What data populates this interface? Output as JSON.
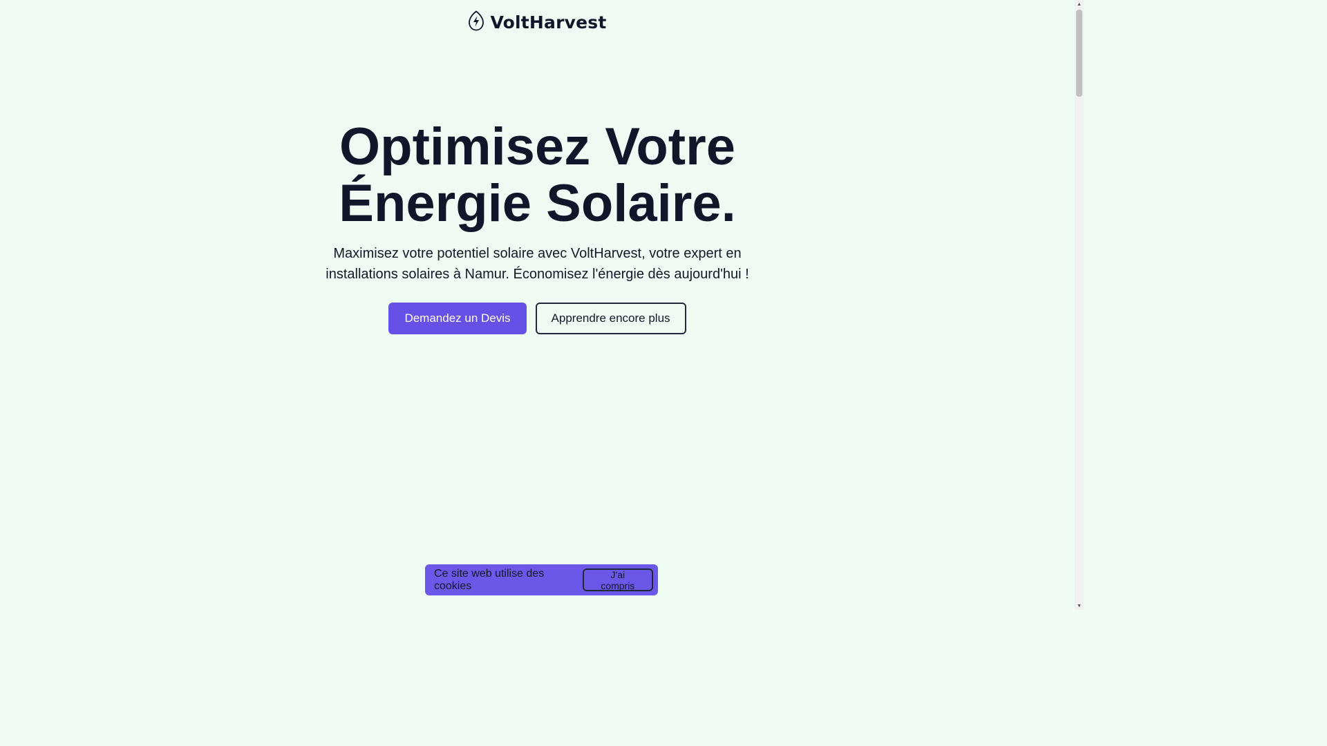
{
  "header": {
    "brand_name": "VoltHarvest",
    "logo_icon": "lightning-bolt-leaf-icon"
  },
  "hero": {
    "title_line1": "Optimisez Votre",
    "title_line2": "Énergie Solaire.",
    "subtitle": "Maximisez votre potentiel solaire avec VoltHarvest, votre expert en installations solaires à Namur. Économisez l'énergie dès aujourd'hui !",
    "primary_cta": "Demandez un Devis",
    "secondary_cta": "Apprendre encore plus"
  },
  "cookie_banner": {
    "message": "Ce site web utilise des cookies",
    "accept_label": "J'ai compris"
  },
  "colors": {
    "background": "#effcf4",
    "primary": "#6650e5",
    "cookie_bg": "#6b58e8",
    "text": "#0f172a"
  },
  "scrollbar": {
    "up_icon": "▲",
    "down_icon": "▼"
  }
}
